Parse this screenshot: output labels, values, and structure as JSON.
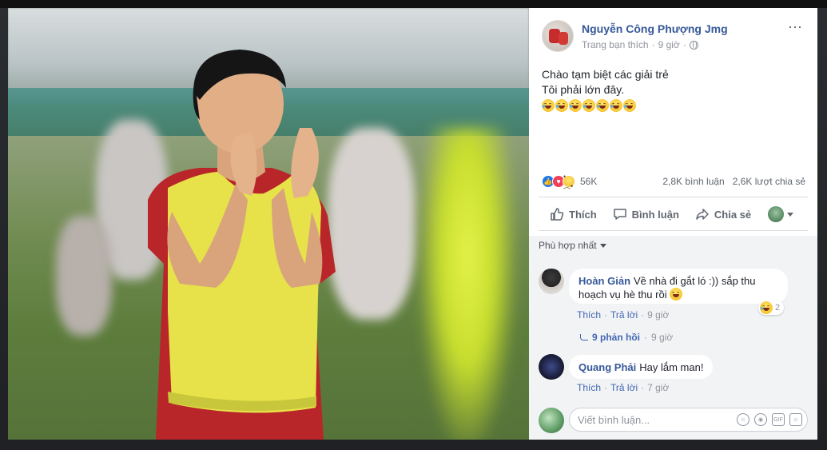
{
  "post": {
    "author": "Nguyễn Công Phượng Jmg",
    "meta_page": "Trang bạn thích",
    "meta_time": "9 giờ",
    "more_icon": "⋯",
    "text_line1": "Chào tạm biệt các giải trẻ",
    "text_line2": "Tôi phải lớn đây.",
    "emoji_count": 7
  },
  "stats": {
    "reactions": "56K",
    "comments": "2,8K bình luận",
    "shares": "2,6K lượt chia sẻ"
  },
  "actions": {
    "like": "Thích",
    "comment": "Bình luận",
    "share": "Chia sẻ"
  },
  "comments": {
    "sort_label": "Phù hợp nhất",
    "items": [
      {
        "name": "Hoàn Giản",
        "text_line1": "Về nhà đi gắt ló :)) sắp thu",
        "text_line2": "hoạch vụ hè thu rồi",
        "like": "Thích",
        "reply": "Trả lời",
        "time": "9 giờ",
        "reaction_count": "2",
        "replies_label": "9 phản hồi",
        "replies_time": "9 giờ"
      },
      {
        "name": "Quang Phải",
        "text": "Hay lắm man!",
        "like": "Thích",
        "reply": "Trả lời",
        "time": "7 giờ"
      }
    ],
    "compose_placeholder": "Viết bình luận..."
  },
  "colors": {
    "link_blue": "#365899",
    "like_blue": "#1877f2",
    "love_red": "#f33e58"
  }
}
